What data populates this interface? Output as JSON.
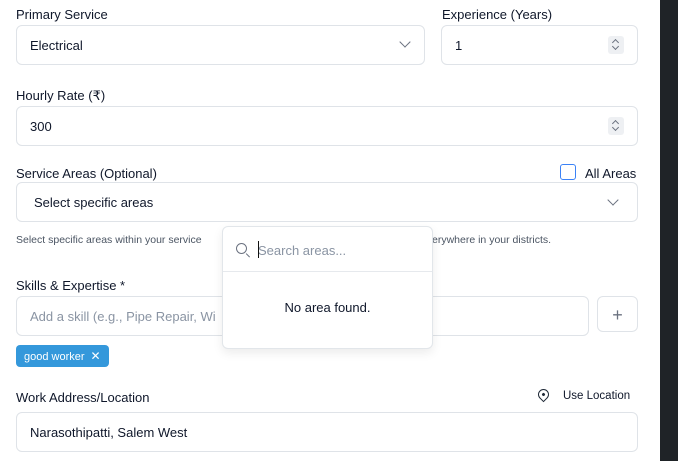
{
  "primary_service": {
    "label": "Primary Service",
    "value": "Electrical"
  },
  "experience": {
    "label": "Experience (Years)",
    "value": "1"
  },
  "hourly_rate": {
    "label": "Hourly Rate (₹)",
    "value": "300"
  },
  "service_areas": {
    "label": "Service Areas (Optional)",
    "all_areas_label": "All Areas",
    "select_placeholder": "Select specific areas",
    "help_text_left": "Select specific areas within your service",
    "help_text_right": "erywhere in your districts.",
    "dropdown": {
      "search_placeholder": "Search areas...",
      "empty_text": "No area found."
    }
  },
  "skills": {
    "label": "Skills & Expertise *",
    "input_placeholder": "Add a skill (e.g., Pipe Repair, Wi",
    "add_button": "+",
    "tags": [
      {
        "label": "good worker",
        "remove": "✕"
      }
    ]
  },
  "work_address": {
    "label": "Work Address/Location",
    "use_location_label": "Use Location",
    "value": "Narasothipatti, Salem West"
  },
  "colors": {
    "tag_bg": "#3498db",
    "checkbox_border": "#3b82f6",
    "scrollbar": "#1f2327"
  }
}
